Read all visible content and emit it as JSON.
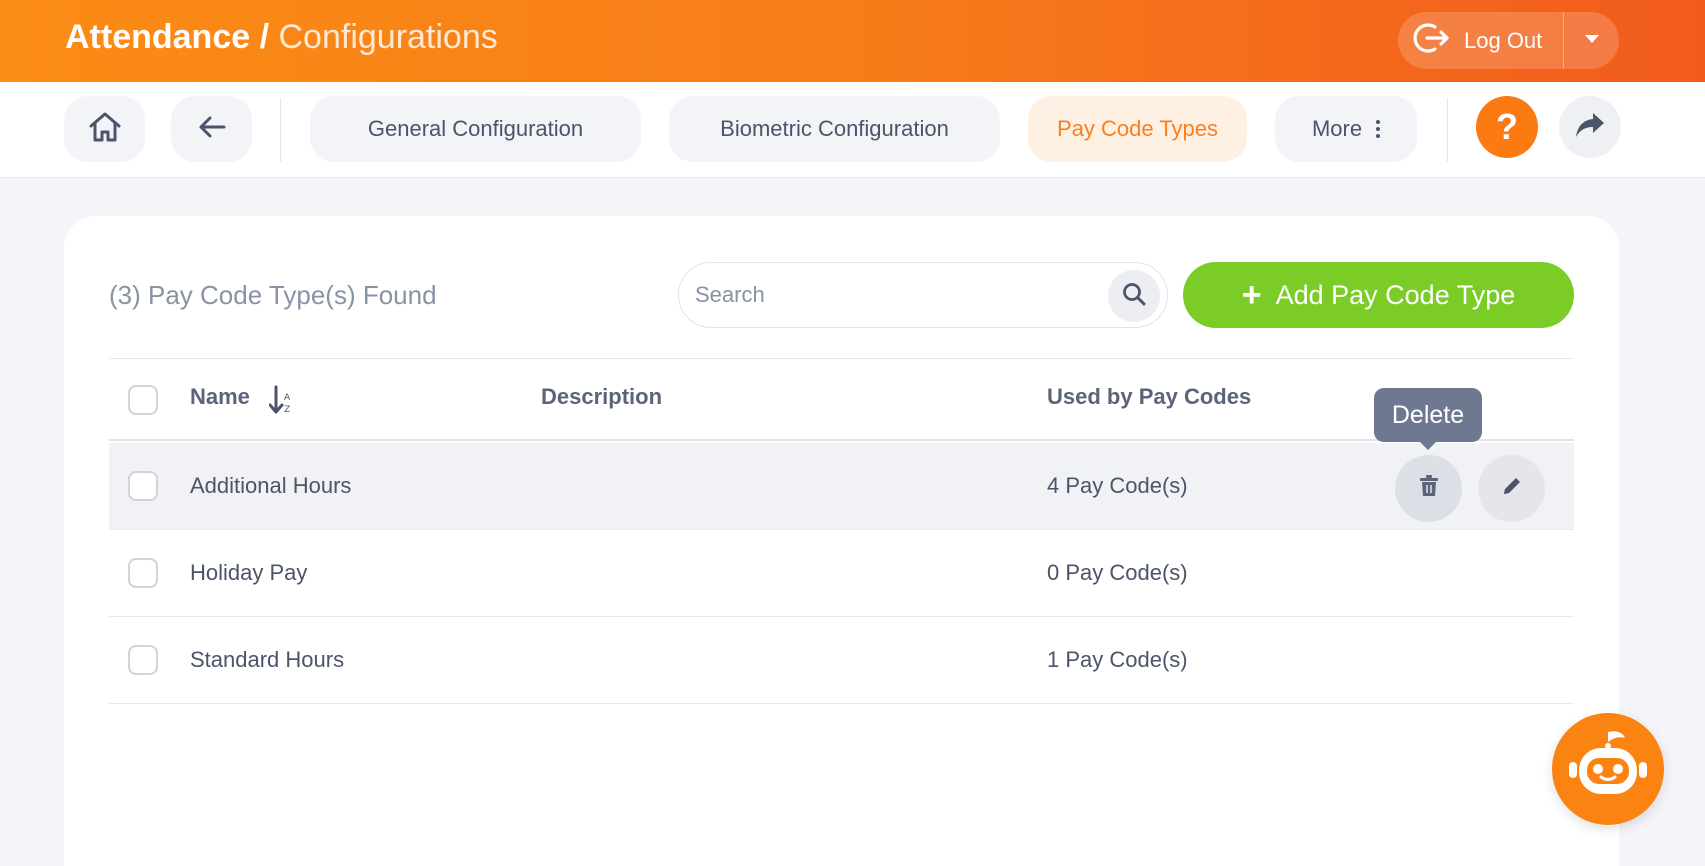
{
  "header": {
    "title_main": "Attendance /",
    "title_sub": "Configurations",
    "logout_label": "Log Out"
  },
  "nav": {
    "tabs": [
      {
        "label": "General Configuration",
        "active": false
      },
      {
        "label": "Biometric Configuration",
        "active": false
      },
      {
        "label": "Pay Code Types",
        "active": true
      },
      {
        "label": "More",
        "active": false
      }
    ],
    "help_label": "?"
  },
  "main": {
    "found_text": "(3) Pay Code Type(s) Found",
    "search": {
      "placeholder": "Search",
      "value": ""
    },
    "add_button_label": "Add Pay Code Type",
    "table": {
      "columns": [
        "Name",
        "Description",
        "Used by Pay Codes"
      ],
      "rows": [
        {
          "name": "Additional Hours",
          "description": "",
          "used": "4 Pay Code(s)"
        },
        {
          "name": "Holiday Pay",
          "description": "",
          "used": "0 Pay Code(s)"
        },
        {
          "name": "Standard Hours",
          "description": "",
          "used": "1 Pay Code(s)"
        }
      ]
    },
    "tooltip": "Delete"
  },
  "icons": {
    "home": "home-icon",
    "back": "arrow-left-icon",
    "logout": "logout-icon",
    "caret": "caret-down-icon",
    "more": "vertical-dots-icon",
    "help": "question-icon",
    "share": "share-icon",
    "search": "search-icon",
    "sort": "sort-alpha-down-icon",
    "delete": "trash-icon",
    "edit": "pencil-icon",
    "bot": "robot-assistant-icon"
  },
  "colors": {
    "accent": "#fb7f1c",
    "add_button": "#7ccc27",
    "tooltip": "#6e7891"
  }
}
